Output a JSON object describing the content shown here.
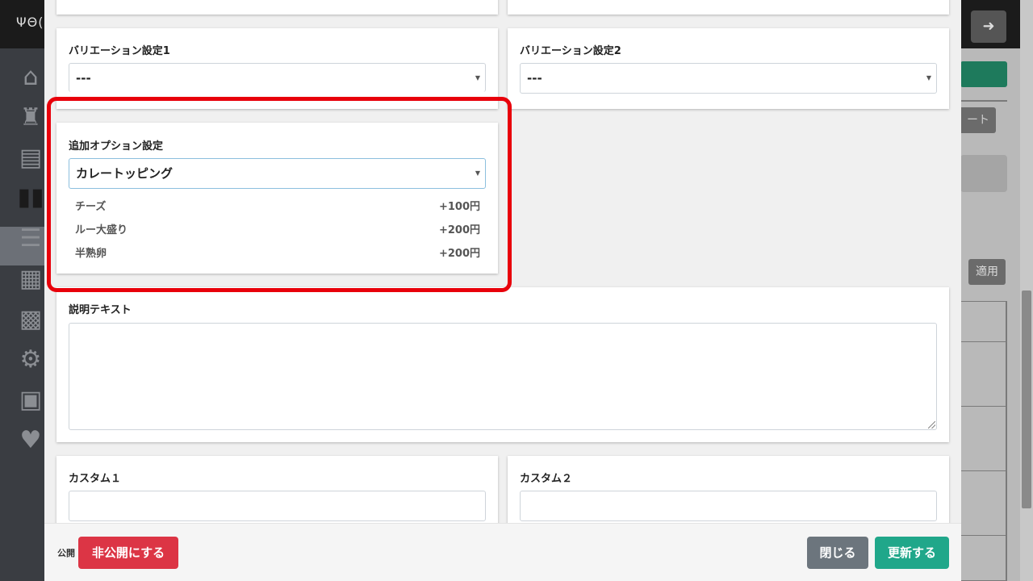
{
  "background": {
    "logo_text": "ΨΘ(",
    "logout_icon": "sign-out-icon",
    "export_partial": "ート",
    "apply_label": "適用"
  },
  "sidebar": {
    "icons": [
      "home-icon",
      "restaurant-icon",
      "register-icon",
      "menu-book-icon",
      "list-icon",
      "store-icon",
      "qr-code-icon",
      "gear-icon",
      "id-card-icon",
      "heart-hand-icon"
    ]
  },
  "modal": {
    "variation1": {
      "label": "バリエーション設定1",
      "value": "---"
    },
    "variation2": {
      "label": "バリエーション設定2",
      "value": "---"
    },
    "addon": {
      "label": "追加オプション設定",
      "value": "カレートッピング",
      "options": [
        {
          "name": "チーズ",
          "price": "+100円"
        },
        {
          "name": "ルー大盛り",
          "price": "+200円"
        },
        {
          "name": "半熟卵",
          "price": "+200円"
        }
      ]
    },
    "description": {
      "label": "説明テキスト",
      "value": ""
    },
    "custom1": {
      "label": "カスタム１",
      "value": ""
    },
    "custom2": {
      "label": "カスタム２",
      "value": ""
    }
  },
  "footer": {
    "publish_label": "公開",
    "unpublish_button": "非公開にする",
    "close_button": "閉じる",
    "update_button": "更新する"
  },
  "colors": {
    "danger": "#dc3545",
    "secondary": "#6c757d",
    "success": "#20a78a",
    "highlight": "#e8000b"
  }
}
